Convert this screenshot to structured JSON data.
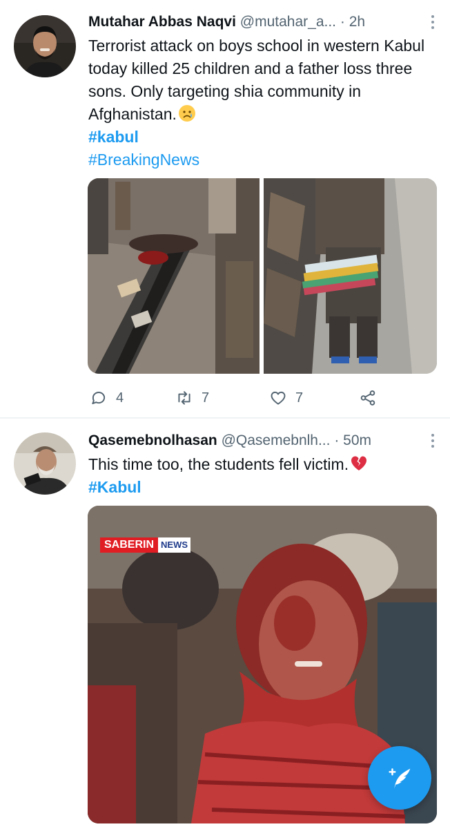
{
  "tweets": [
    {
      "author_name": "Mutahar Abbas Naqvi",
      "handle": "@mutahar_a...",
      "separator": "·",
      "time": "2h",
      "text": "Terrorist attack on boys school in western Kabul today killed 25 children and a father loss three sons. Only targeting shia community in Afghanistan.",
      "text_emoji": "sad-face-emoji",
      "hashtags": [
        "#kabul",
        "#BreakingNews"
      ],
      "media": [
        "photo-street-attack-scene",
        "photo-child-holding-books"
      ],
      "actions": {
        "reply_count": "4",
        "retweet_count": "7",
        "like_count": "7"
      }
    },
    {
      "author_name": "Qasemebnolhasan",
      "handle": "@Qasemebnlh...",
      "separator": "·",
      "time": "50m",
      "text": "This time too, the students fell victim.",
      "text_emoji": "broken-heart-emoji",
      "hashtags": [
        "#Kabul"
      ],
      "media": [
        "photo-injured-girl"
      ],
      "watermark_text": [
        "SABERIN",
        "NEWS"
      ]
    }
  ],
  "icons": {
    "reply": "reply-icon",
    "retweet": "retweet-icon",
    "like": "heart-icon",
    "share": "share-icon",
    "more": "more-dots-icon",
    "compose": "compose-tweet-icon"
  },
  "colors": {
    "accent": "#1d9bf0",
    "text_primary": "#0f1419",
    "text_secondary": "#536471",
    "divider": "#eff3f4"
  }
}
